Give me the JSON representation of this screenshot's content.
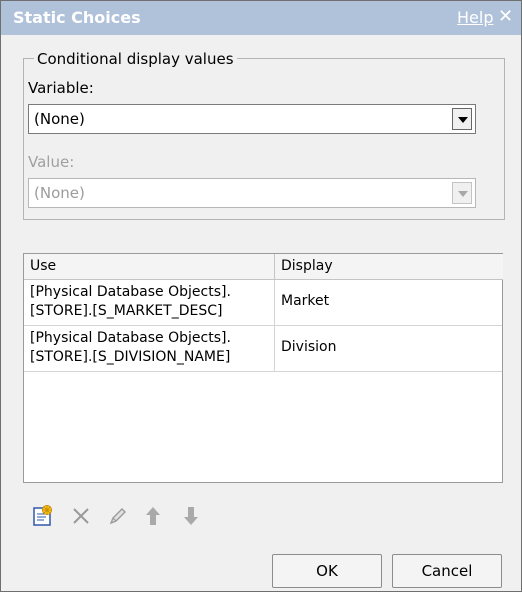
{
  "dialog": {
    "title": "Static Choices",
    "help_label": "Help",
    "close_glyph": "✕"
  },
  "conditional": {
    "legend": "Conditional display values",
    "variable_label": "Variable:",
    "variable_value": "(None)",
    "value_label": "Value:",
    "value_value": "(None)"
  },
  "table": {
    "headers": [
      "Use",
      "Display"
    ],
    "rows": [
      {
        "use_line1": "[Physical Database Objects].",
        "use_line2": "[STORE].[S_MARKET_DESC]",
        "display": "Market"
      },
      {
        "use_line1": "[Physical Database Objects].",
        "use_line2": "[STORE].[S_DIVISION_NAME]",
        "display": "Division"
      }
    ]
  },
  "toolbar": {
    "icons": [
      "new-item-icon",
      "delete-icon",
      "edit-icon",
      "move-up-icon",
      "move-down-icon"
    ]
  },
  "buttons": {
    "ok": "OK",
    "cancel": "Cancel"
  }
}
